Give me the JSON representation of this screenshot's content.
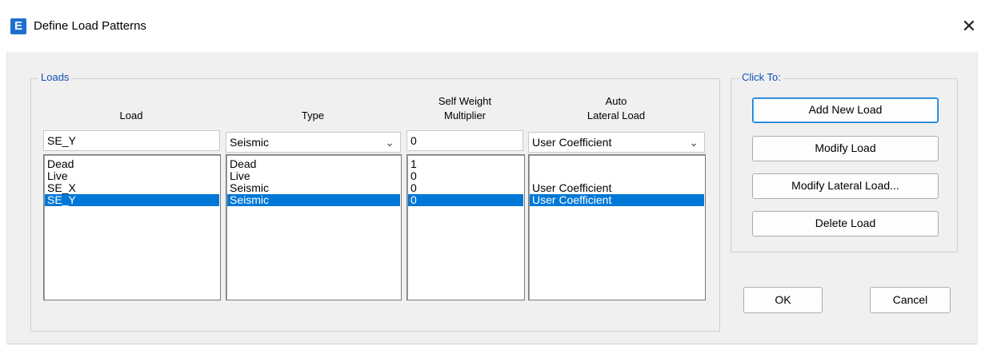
{
  "window": {
    "icon_glyph": "E",
    "title": "Define Load Patterns",
    "close_glyph": "✕"
  },
  "loads_group": {
    "legend": "Loads",
    "headers": {
      "load": "Load",
      "type": "Type",
      "self_weight_line1": "Self Weight",
      "self_weight_line2": "Multiplier",
      "auto_line1": "Auto",
      "auto_line2": "Lateral Load"
    },
    "edit": {
      "load": "SE_Y",
      "type": "Seismic",
      "self_weight": "0",
      "auto_lateral": "User Coefficient"
    },
    "rows": [
      {
        "load": "Dead",
        "type": "Dead",
        "self_weight": "1",
        "auto_lateral": ""
      },
      {
        "load": "Live",
        "type": "Live",
        "self_weight": "0",
        "auto_lateral": ""
      },
      {
        "load": "SE_X",
        "type": "Seismic",
        "self_weight": "0",
        "auto_lateral": "User Coefficient"
      },
      {
        "load": "SE_Y",
        "type": "Seismic",
        "self_weight": "0",
        "auto_lateral": "User Coefficient"
      }
    ],
    "selected_row": 3
  },
  "click_group": {
    "legend": "Click To:",
    "add": "Add New Load",
    "modify": "Modify Load",
    "modify_lateral": "Modify Lateral Load...",
    "delete": "Delete Load"
  },
  "footer": {
    "ok": "OK",
    "cancel": "Cancel"
  },
  "colors": {
    "selection": "#0078d7",
    "legend_text": "#0f4fb8",
    "app_icon": "#1f6fd1"
  },
  "icons": {
    "app": "etabs-app-icon",
    "close": "close-icon",
    "dropdown": "chevron-down-icon"
  }
}
